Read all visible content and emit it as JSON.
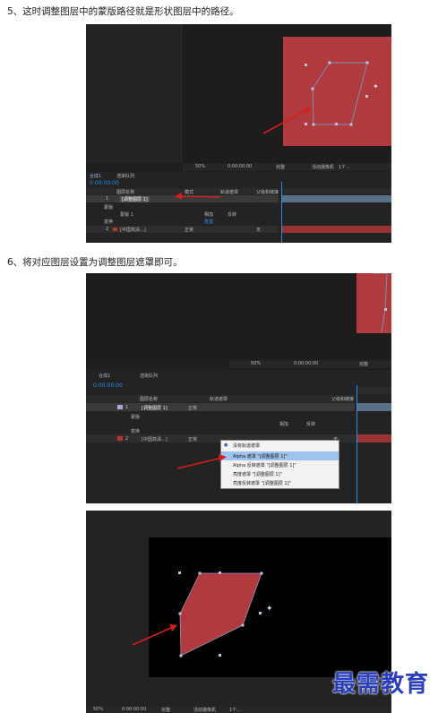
{
  "steps": {
    "step5": "5、这时调整图层中的蒙版路径就是形状图层中的路径。",
    "step6": "6、将对应图层设置为调整图层遮罩即可。"
  },
  "shot1": {
    "zoom": "50%",
    "timecode": "0:00:00:00",
    "quality": "完整",
    "camera": "活动摄像机",
    "view": "1个...",
    "comp_tab": "合成1",
    "render_queue": "渲染队列",
    "time_display": "0:00:00:00",
    "col_layer_name": "图层名称",
    "col_mode": "模式",
    "col_trkmat": "轨道遮罩",
    "col_parent": "父级和链接",
    "layer1_name": "[调整图层 1]",
    "layer1_num": "1",
    "sub_mask": "蒙版",
    "sub_mask1": "蒙版 1",
    "sub_add": "相加",
    "sub_invert": "反转",
    "sub_transform": "变换",
    "sub_reset": "重置",
    "layer2_num": "2",
    "layer2_name": "[中国高清...]",
    "mode_normal": "正常",
    "none": "无"
  },
  "shot2": {
    "zoom": "50%",
    "timecode": "0:00:00:00",
    "quality": "完整",
    "comp_tab": "合成1",
    "render_queue": "渲染队列",
    "time_display": "0:00:00:00",
    "col_layer_name": "图层名称",
    "col_trkmat": "轨道遮罩",
    "col_parent": "父级和链接",
    "layer1_num": "1",
    "layer1_name": "[调整图层 1]",
    "mode_normal": "正常",
    "sub_mask": "蒙版",
    "sub_add": "相加",
    "sub_invert": "反转",
    "sub_transform": "变换",
    "layer2_num": "2",
    "layer2_name": "[中国高清...]",
    "none": "无",
    "menu": [
      "没有轨道遮罩",
      "Alpha 遮罩 \"[调整图层 1]\"",
      "Alpha 反转遮罩 \"[调整图层 1]\"",
      "亮度遮罩 \"[调整图层 1]\"",
      "亮度反转遮罩 \"[调整图层 1]\""
    ]
  },
  "shot3": {
    "zoom": "50%",
    "timecode": "0:00:00:00",
    "quality": "完整",
    "camera": "活动摄像机",
    "view": "1个..."
  },
  "watermark": "最需教育",
  "colors": {
    "shape_red": "#b03a3e",
    "panel_dark": "#1e1e1e",
    "accent_blue": "#2d8ceb",
    "arrow_red": "#d02020"
  }
}
